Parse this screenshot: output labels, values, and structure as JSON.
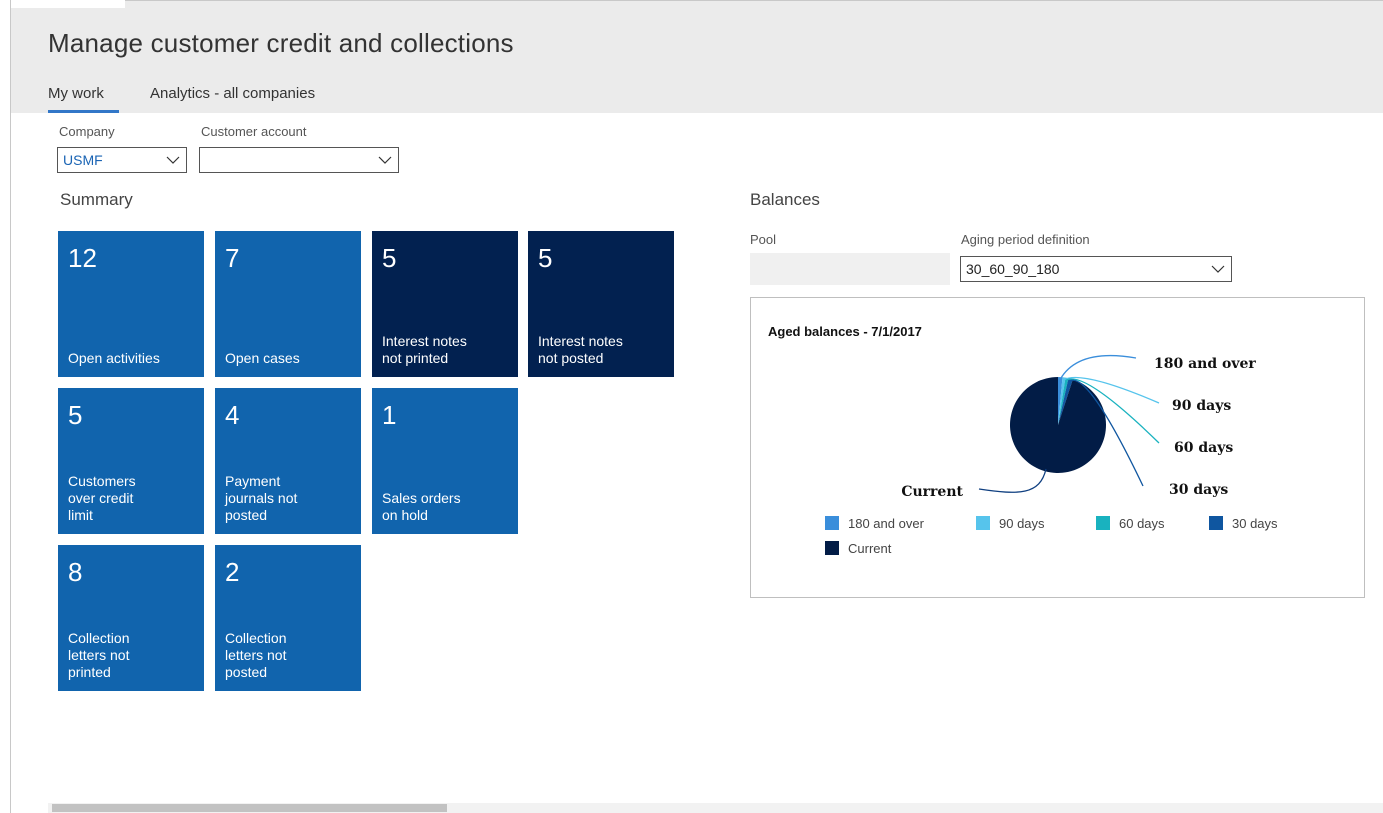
{
  "page": {
    "title": "Manage customer credit and collections"
  },
  "tabs": [
    {
      "label": "My work"
    },
    {
      "label": "Analytics - all companies"
    }
  ],
  "filters": {
    "company": {
      "label": "Company",
      "value": "USMF"
    },
    "customer_account": {
      "label": "Customer account",
      "value": ""
    }
  },
  "summary": {
    "label": "Summary",
    "tiles": [
      {
        "count": "12",
        "label": "Open activities",
        "style": "blue"
      },
      {
        "count": "7",
        "label": "Open cases",
        "style": "blue"
      },
      {
        "count": "5",
        "label": "Interest notes\nnot printed",
        "style": "navy"
      },
      {
        "count": "5",
        "label": "Interest notes\nnot posted",
        "style": "navy"
      },
      {
        "count": "5",
        "label": "Customers\nover credit\nlimit",
        "style": "blue"
      },
      {
        "count": "4",
        "label": "Payment\njournals not\nposted",
        "style": "blue"
      },
      {
        "count": "1",
        "label": "Sales orders\non hold",
        "style": "blue"
      },
      {
        "count": "8",
        "label": "Collection\nletters not\nprinted",
        "style": "blue"
      },
      {
        "count": "2",
        "label": "Collection\nletters not\nposted",
        "style": "blue"
      }
    ]
  },
  "balances": {
    "label": "Balances",
    "pool": {
      "label": "Pool",
      "value": ""
    },
    "aging_period": {
      "label": "Aging period definition",
      "value": "30_60_90_180"
    }
  },
  "chart_data": {
    "type": "pie",
    "title": "Aged balances - 7/1/2017",
    "slices": [
      {
        "label": "180 and over",
        "value": 1.5,
        "color": "#3a8edb"
      },
      {
        "label": "90 days",
        "value": 1.0,
        "color": "#56c4ec"
      },
      {
        "label": "60 days",
        "value": 1.0,
        "color": "#19b2bf"
      },
      {
        "label": "30 days",
        "value": 1.5,
        "color": "#0f56a0"
      },
      {
        "label": "Current",
        "value": 95.0,
        "color": "#021c46"
      }
    ],
    "legend": [
      "180 and over",
      "90 days",
      "60 days",
      "30 days",
      "Current"
    ],
    "legend_position": "bottom"
  }
}
